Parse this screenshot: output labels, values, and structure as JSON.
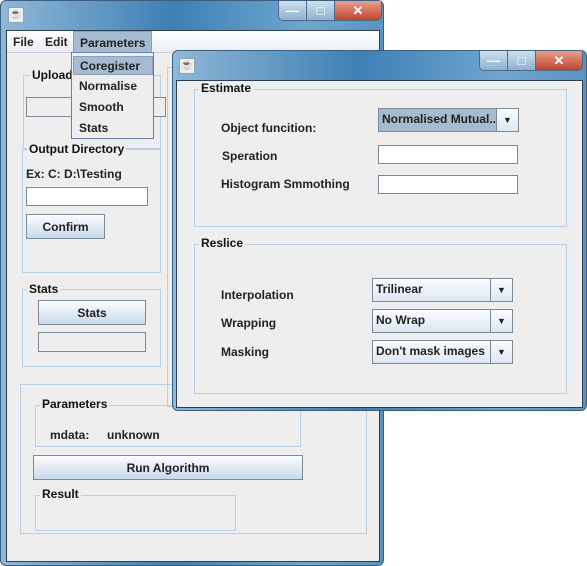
{
  "main_window": {
    "menubar": [
      {
        "label": "File"
      },
      {
        "label": "Edit"
      },
      {
        "label": "Parameters"
      }
    ],
    "parameters_menu": [
      {
        "label": "Coregister",
        "highlighted": true
      },
      {
        "label": "Normalise"
      },
      {
        "label": "Smooth"
      },
      {
        "label": "Stats"
      }
    ],
    "upload_group": {
      "title": "Upload I"
    },
    "output_group": {
      "title": "Output Directory",
      "hint": "Ex: C: D:\\Testing",
      "path_value": "",
      "confirm_label": "Confirm"
    },
    "stats_group": {
      "title": "Stats",
      "button_label": "Stats",
      "value": ""
    },
    "parameters_group": {
      "title": "Parameters",
      "mdata_label": "mdata:",
      "mdata_value": "unknown"
    },
    "run_label": "Run Algorithm",
    "result_group": {
      "title": "Result"
    }
  },
  "dialog": {
    "estimate": {
      "title": "Estimate",
      "object_function_label": "Object funcition:",
      "object_function_value": "Normalised Mutual...",
      "separation_label": "Speration",
      "separation_value": "",
      "histogram_label": "Histogram Smmothing",
      "histogram_value": ""
    },
    "reslice": {
      "title": "Reslice",
      "interpolation_label": "Interpolation",
      "interpolation_value": "Trilinear",
      "wrapping_label": "Wrapping",
      "wrapping_value": "No Wrap",
      "masking_label": "Masking",
      "masking_value": "Don't mask images"
    }
  },
  "window_controls": {
    "minimize": "—",
    "maximize": "□",
    "close": "✕"
  }
}
